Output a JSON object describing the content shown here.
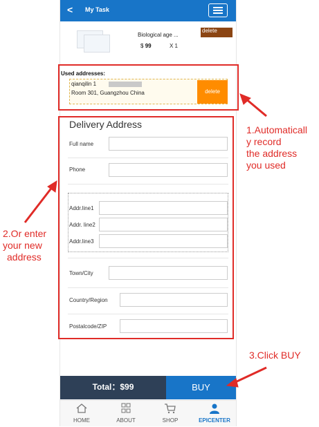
{
  "header": {
    "back_icon": "back-arrow-icon",
    "title": "My Task",
    "menu_icon": "hamburger-menu-icon"
  },
  "product": {
    "name": "Biological age ...",
    "price_symbol": "$",
    "price": "99",
    "quantity": "X 1",
    "delete_label": "delete"
  },
  "used_addresses": {
    "label": "Used addresses:",
    "name": "qianqilin 1",
    "address": "Room 301,  Guangzhou China",
    "delete_label": "delete"
  },
  "form": {
    "title": "Delivery Address",
    "full_name_label": "Full name",
    "phone_label": "Phone",
    "addr1_label": "Addr.line1",
    "addr2_label": "Addr. line2",
    "addr3_label": "Addr.line3",
    "city_label": "Town/City",
    "country_label": "Country/Region",
    "zip_label": "Postalcode/ZIP"
  },
  "footer": {
    "total_label": "Total：$99",
    "buy_label": "BUY"
  },
  "nav": [
    {
      "label": "HOME",
      "icon": "home-icon"
    },
    {
      "label": "ABOUT",
      "icon": "grid-icon"
    },
    {
      "label": "SHOP",
      "icon": "cart-icon"
    },
    {
      "label": "EPICENTER",
      "icon": "user-icon"
    }
  ],
  "annotations": {
    "a1": [
      "1.Automaticall",
      "y record",
      "the address",
      "you used"
    ],
    "a2": [
      "2.Or enter",
      "your new",
      "address"
    ],
    "a3": "3.Click BUY"
  },
  "colors": {
    "primary": "#1875c8",
    "orange": "#ff8c00",
    "annotation_red": "#e02b27",
    "dark_bar": "#2e4057",
    "brown": "#8b4513"
  }
}
